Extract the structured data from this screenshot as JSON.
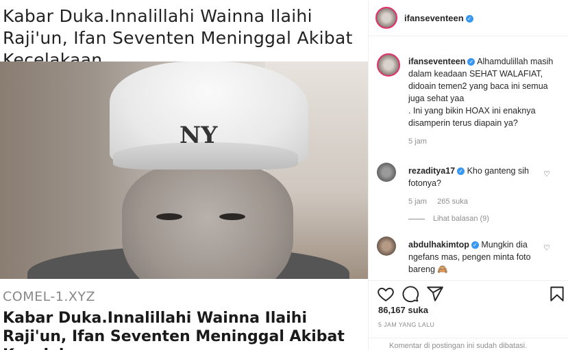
{
  "post_image": {
    "headline_top": "Kabar Duka.Innalillahi Wainna Ilaihi Raji'un, Ifan Seventen Meninggal Akibat Kecelakaan..",
    "cap_logo": "NY",
    "source": "COMEL-1.XYZ",
    "headline_bottom": "Kabar Duka.Innalillahi Wainna Ilaihi Raji'un, Ifan Seventen Meninggal Akibat Kecelakaan.."
  },
  "header": {
    "username": "ifanseventeen",
    "verified_icon": "verified-badge-icon",
    "verified_mark": "✓"
  },
  "caption": {
    "username": "ifanseventeen",
    "verified_mark": "✓",
    "text": "Alhamdulillah masih dalam keadaan SEHAT WALAFIAT, didoain temen2 yang baca ini semua juga sehat yaa",
    "text2": ". Ini yang bikin HOAX ini enaknya disamperin terus diapain ya?",
    "time": "5 jam"
  },
  "comments": [
    {
      "username": "rezaditya17",
      "verified_mark": "✓",
      "text": "Kho ganteng sih fotonya?",
      "time": "5 jam",
      "likes": "265 suka",
      "heart": "♡"
    },
    {
      "username": "abdulhakimtop",
      "verified_mark": "✓",
      "text": "Mungkin dia ngefans mas, pengen minta foto bareng 🙈",
      "heart": "♡"
    }
  ],
  "view_replies": "Lihat balasan (9)",
  "actions": {
    "like_icon": "heart-icon",
    "comment_icon": "comment-icon",
    "share_icon": "share-icon",
    "save_icon": "bookmark-icon"
  },
  "likes": "86,167 suka",
  "time_ago": "5 JAM YANG LALU",
  "comments_disabled": "Komentar di postingan ini sudah dibatasi."
}
